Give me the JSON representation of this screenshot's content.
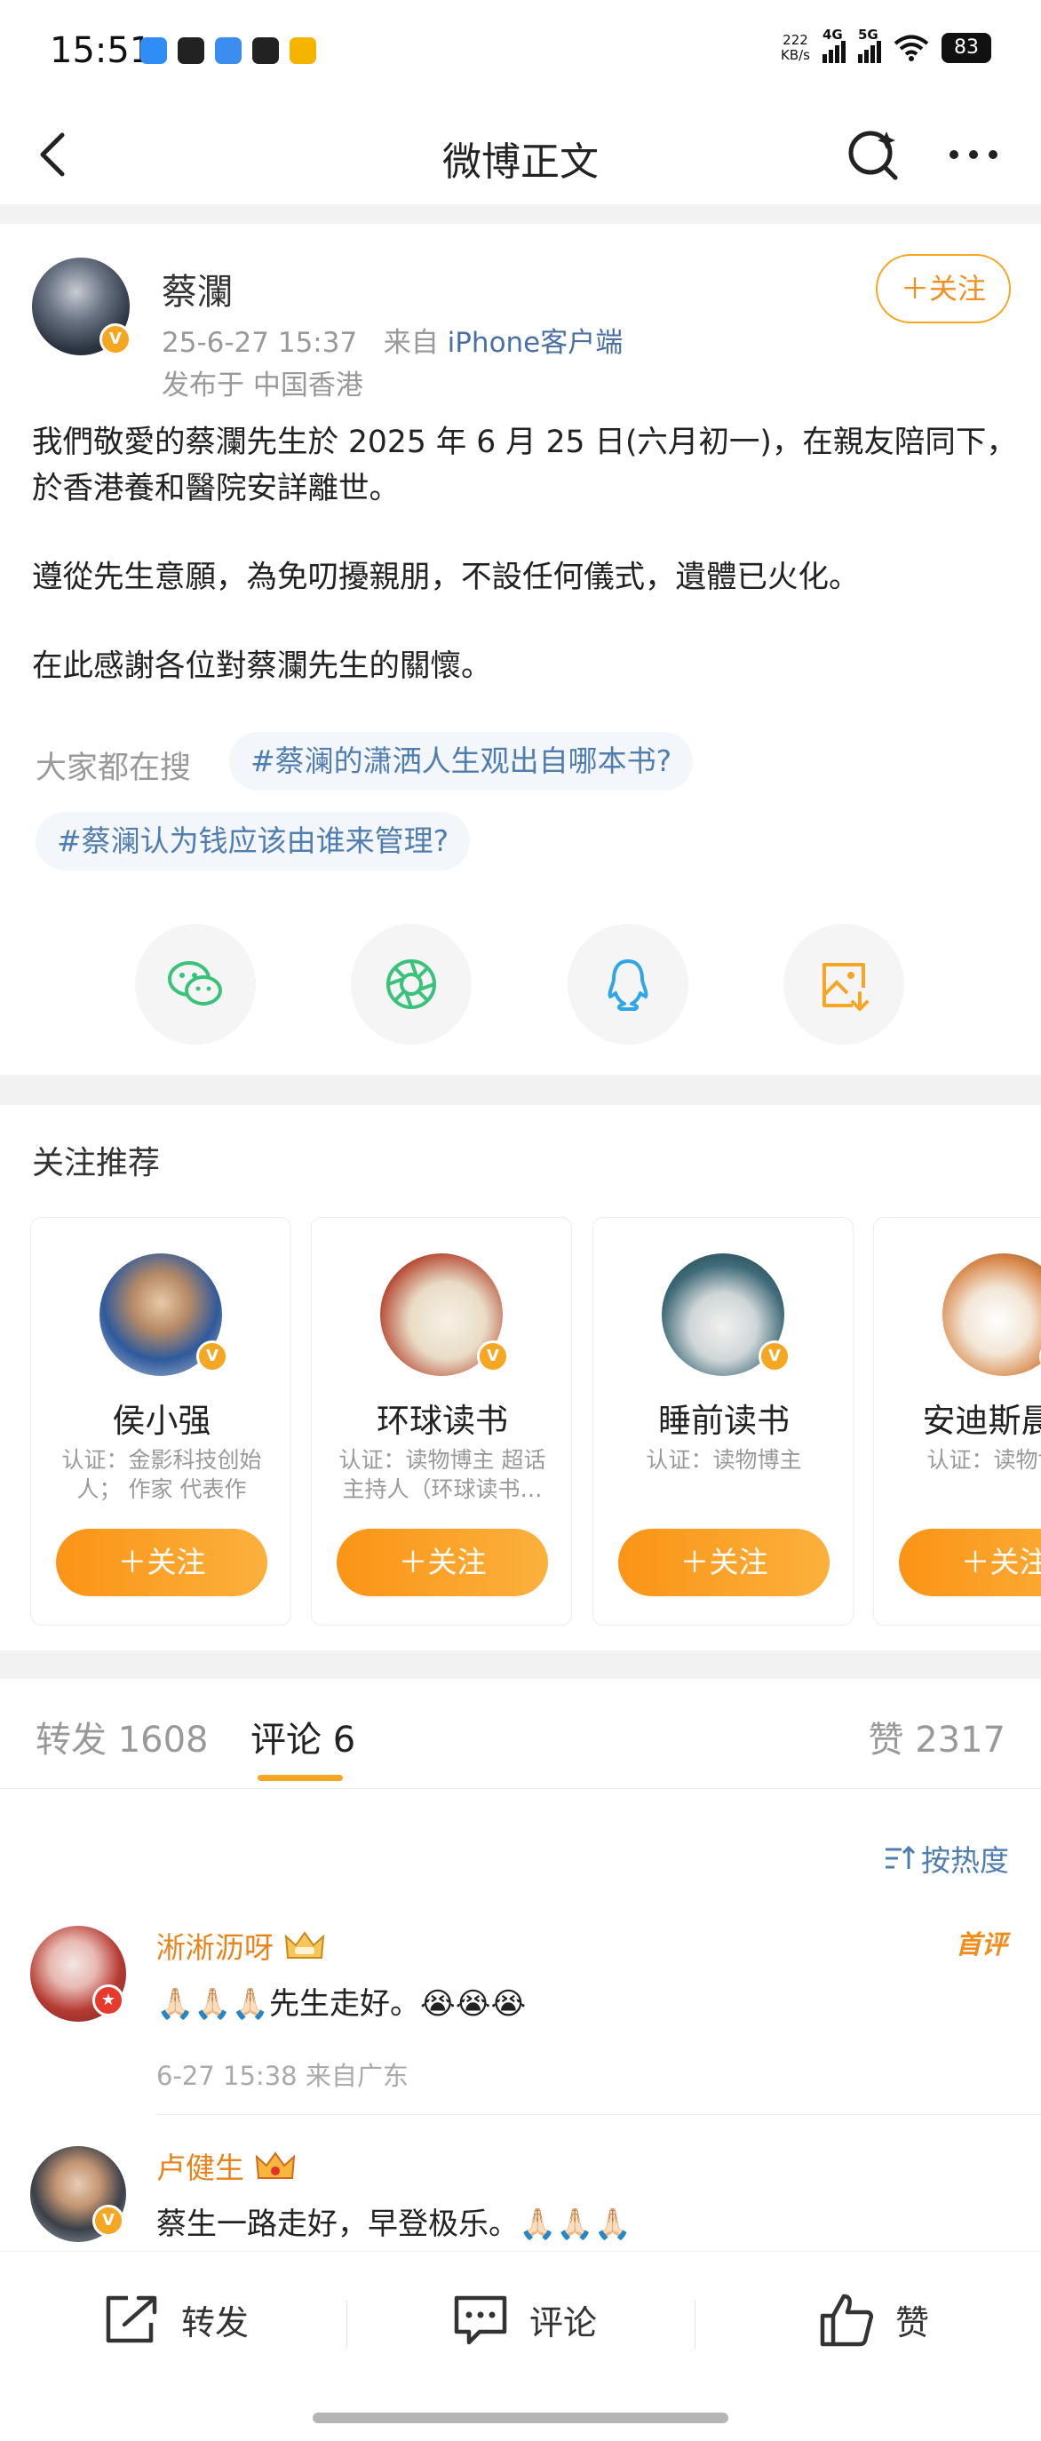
{
  "status_bar": {
    "time": "15:51",
    "net_speed_value": "222",
    "net_speed_unit": "KB/s",
    "signal_1": "4G",
    "signal_2": "5G",
    "battery": "83"
  },
  "nav": {
    "title": "微博正文"
  },
  "post": {
    "author": "蔡瀾",
    "time": "25-6-27 15:37",
    "source_prefix": "来自",
    "source": "iPhone客户端",
    "location": "发布于 中国香港",
    "follow_label": "关注",
    "paragraphs": [
      "我們敬愛的蔡瀾先生於 2025 年 6 月 25 日(六月初一)，在親友陪同下，於香港養和醫院安詳離世。",
      "遵從先生意願，為免叨擾親朋，不設任何儀式，遺體已火化。",
      "在此感謝各位對蔡瀾先生的關懷。"
    ]
  },
  "search": {
    "label": "大家都在搜",
    "topics": [
      "#蔡澜的潇洒人生观出自哪本书?",
      "#蔡澜认为钱应该由谁来管理?"
    ]
  },
  "share": {
    "icons": [
      "wechat-icon",
      "moments-icon",
      "qq-icon",
      "save-image-icon"
    ]
  },
  "recommend": {
    "title": "关注推荐",
    "follow_label": "关注",
    "cards": [
      {
        "name": "侯小强",
        "desc": "认证：金影科技创始人； 作家 代表作《…"
      },
      {
        "name": "环球读书",
        "desc": "认证：读物博主 超话主持人（环球读书…"
      },
      {
        "name": "睡前读书",
        "desc": "认证：读物博主"
      },
      {
        "name": "安迪斯晨风",
        "desc": "认证：读物博主"
      }
    ]
  },
  "tabs": {
    "repost": "转发 1608",
    "comment": "评论 6",
    "like": "赞 2317"
  },
  "sort_label": "按热度",
  "comments": [
    {
      "name": "淅淅沥呀",
      "text": "🙏🏻🙏🏻🙏🏻先生走好。😭😭😭",
      "meta": "6-27 15:38  来自广东",
      "badge": "首评"
    },
    {
      "name": "卢健生",
      "text": "蔡生一路走好，早登极乐。🙏🏻🙏🏻🙏🏻"
    }
  ],
  "bottom_bar": {
    "repost": "转发",
    "comment": "评论",
    "like": "赞"
  },
  "colors": {
    "accent": "#f5a623",
    "link": "#507daf",
    "name_orange": "#e8831a"
  }
}
